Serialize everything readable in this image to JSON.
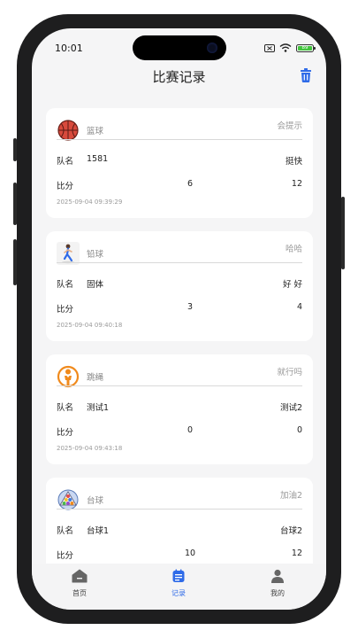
{
  "status": {
    "time": "10:01",
    "battery": "89"
  },
  "header": {
    "title": "比赛记录"
  },
  "colors": {
    "accent": "#2f6be8"
  },
  "records": [
    {
      "icon": "basketball-icon",
      "sport": "篮球",
      "note": "会提示",
      "team_label": "队名",
      "team1": "1581",
      "team2": "挺快",
      "score_label": "比分",
      "score1": "6",
      "score2": "12",
      "date": "2025-09-04 09:39:29"
    },
    {
      "icon": "runner-icon",
      "sport": "铅球",
      "note": "哈哈",
      "team_label": "队名",
      "team1": "固体",
      "team2": "好 好",
      "score_label": "比分",
      "score1": "3",
      "score2": "4",
      "date": "2025-09-04 09:40:18"
    },
    {
      "icon": "jump-rope-icon",
      "sport": "跳绳",
      "note": "就行吗",
      "team_label": "队名",
      "team1": "测试1",
      "team2": "测试2",
      "score_label": "比分",
      "score1": "0",
      "score2": "0",
      "date": "2025-09-04 09:43:18"
    },
    {
      "icon": "billiards-icon",
      "sport": "台球",
      "note": "加油2",
      "team_label": "队名",
      "team1": "台球1",
      "team2": "台球2",
      "score_label": "比分",
      "score1": "10",
      "score2": "12",
      "date": ""
    }
  ],
  "tabs": [
    {
      "label": "首页",
      "icon": "home-icon"
    },
    {
      "label": "记录",
      "icon": "records-icon"
    },
    {
      "label": "我的",
      "icon": "profile-icon"
    }
  ]
}
